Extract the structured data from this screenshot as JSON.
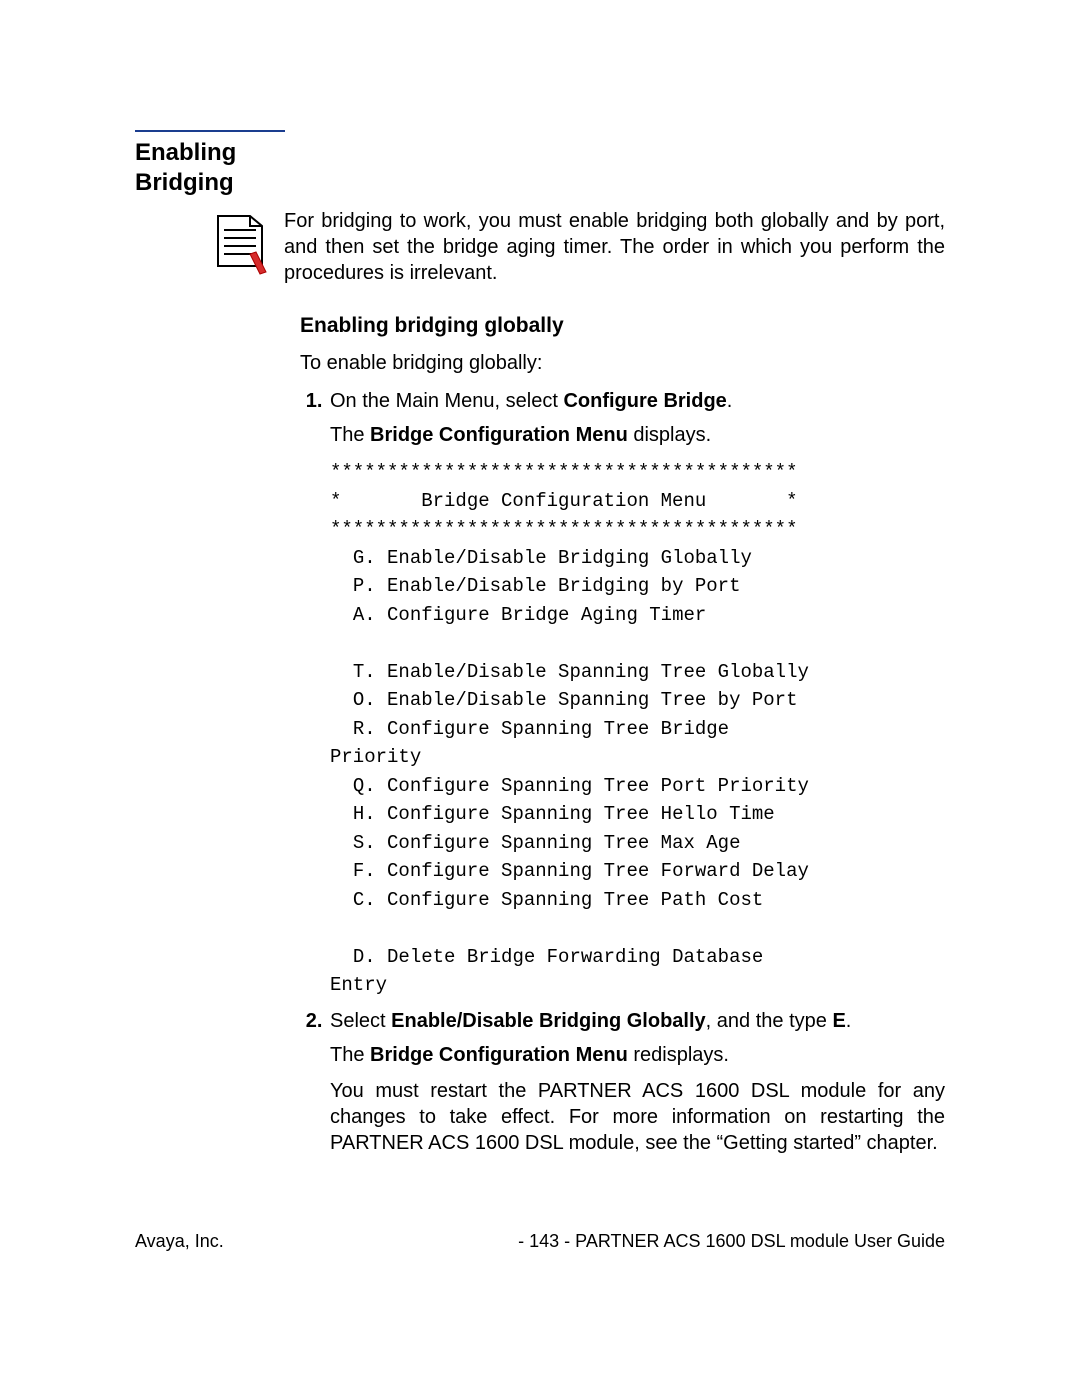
{
  "section": {
    "title_line1": "Enabling",
    "title_line2": "Bridging"
  },
  "intro": "For bridging to work, you must enable bridging both globally and by port, and then set the bridge aging timer.  The order in which you perform the procedures is irrelevant.",
  "sub_heading": "Enabling bridging globally",
  "lead_in": "To enable bridging globally:",
  "steps": {
    "s1": {
      "pre": "On the Main Menu, select ",
      "bold1": "Configure Bridge",
      "post1": ".",
      "line2_pre": "The ",
      "line2_bold": "Bridge Configuration Menu",
      "line2_post": " displays."
    },
    "menu": "*****************************************\n*       Bridge Configuration Menu       *\n*****************************************\n  G. Enable/Disable Bridging Globally\n  P. Enable/Disable Bridging by Port\n  A. Configure Bridge Aging Timer\n\n  T. Enable/Disable Spanning Tree Globally\n  O. Enable/Disable Spanning Tree by Port\n  R. Configure Spanning Tree Bridge\nPriority\n  Q. Configure Spanning Tree Port Priority\n  H. Configure Spanning Tree Hello Time\n  S. Configure Spanning Tree Max Age\n  F. Configure Spanning Tree Forward Delay\n  C. Configure Spanning Tree Path Cost\n\n  D. Delete Bridge Forwarding Database\nEntry",
    "s2": {
      "pre": "Select ",
      "bold1": "Enable/Disable Bridging Globally",
      "mid": ", and the type ",
      "bold2": "E",
      "post": ".",
      "line2_pre": "The ",
      "line2_bold": "Bridge Configuration Menu",
      "line2_post": " redisplays.",
      "restart": "You must restart the PARTNER ACS 1600 DSL module for any changes to take effect.  For more information on restarting the PARTNER ACS 1600 DSL module, see the “Getting started” chapter."
    }
  },
  "footer": {
    "left": "Avaya, Inc.",
    "right": "- 143 - PARTNER ACS 1600 DSL module User Guide"
  }
}
